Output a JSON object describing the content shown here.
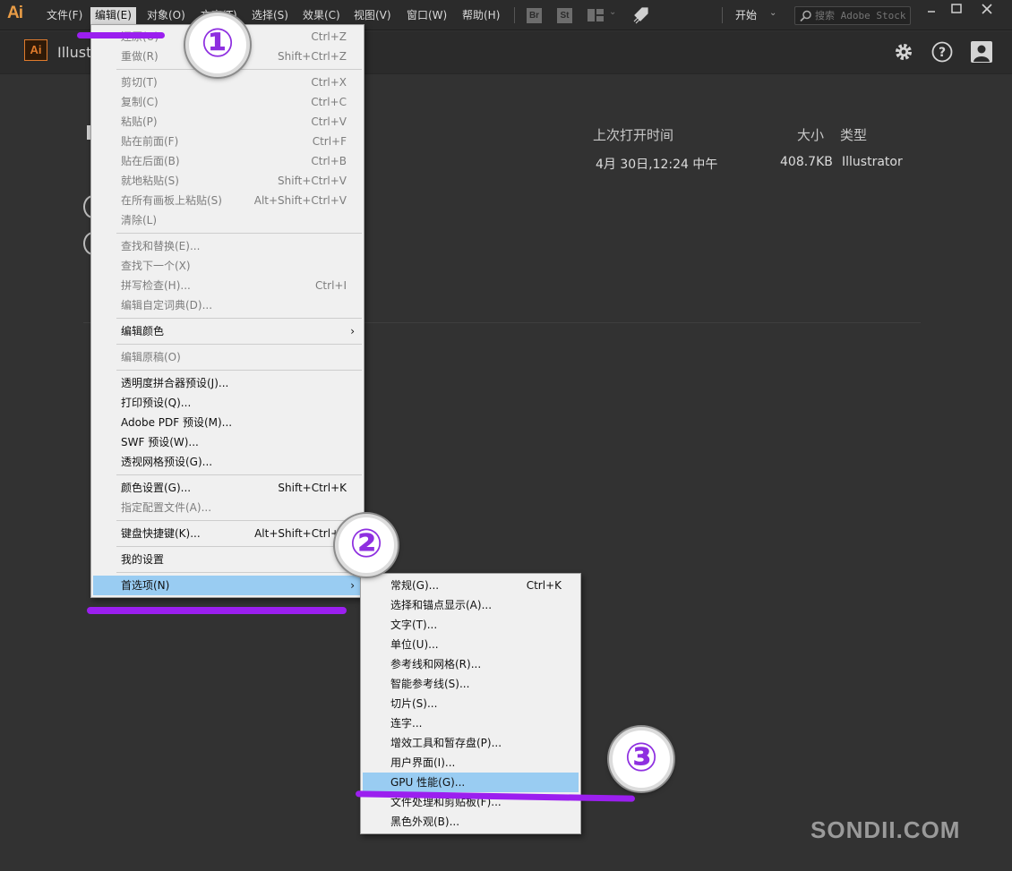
{
  "app": {
    "logo": "Ai",
    "name": "Illust"
  },
  "menubar": {
    "items": [
      {
        "label": "文件(F)"
      },
      {
        "label": "编辑(E)"
      },
      {
        "label": "对象(O)"
      },
      {
        "label": "文字(T)"
      },
      {
        "label": "选择(S)"
      },
      {
        "label": "效果(C)"
      },
      {
        "label": "视图(V)"
      },
      {
        "label": "窗口(W)"
      },
      {
        "label": "帮助(H)"
      }
    ],
    "bridge_icon": "Br",
    "stock_icon": "St",
    "workspace": "开始",
    "search_placeholder": "搜索 Adobe Stock"
  },
  "recent": {
    "columns": {
      "last_opened": "上次打开时间",
      "size": "大小",
      "type": "类型"
    },
    "row": {
      "last_opened": "4月 30日,12:24 中午",
      "size": "408.7KB",
      "type": "Illustrator"
    }
  },
  "edit_menu": {
    "items": [
      {
        "label": "还原(U)",
        "shortcut": "Ctrl+Z"
      },
      {
        "label": "重做(R)",
        "shortcut": "Shift+Ctrl+Z"
      },
      {
        "label": "剪切(T)",
        "shortcut": "Ctrl+X"
      },
      {
        "label": "复制(C)",
        "shortcut": "Ctrl+C"
      },
      {
        "label": "粘贴(P)",
        "shortcut": "Ctrl+V"
      },
      {
        "label": "贴在前面(F)",
        "shortcut": "Ctrl+F"
      },
      {
        "label": "贴在后面(B)",
        "shortcut": "Ctrl+B"
      },
      {
        "label": "就地粘贴(S)",
        "shortcut": "Shift+Ctrl+V"
      },
      {
        "label": "在所有画板上粘贴(S)",
        "shortcut": "Alt+Shift+Ctrl+V"
      },
      {
        "label": "清除(L)",
        "shortcut": ""
      },
      {
        "label": "查找和替换(E)...",
        "shortcut": ""
      },
      {
        "label": "查找下一个(X)",
        "shortcut": ""
      },
      {
        "label": "拼写检查(H)...",
        "shortcut": "Ctrl+I"
      },
      {
        "label": "编辑自定词典(D)...",
        "shortcut": ""
      },
      {
        "label": "编辑颜色",
        "shortcut": ""
      },
      {
        "label": "编辑原稿(O)",
        "shortcut": ""
      },
      {
        "label": "透明度拼合器预设(J)...",
        "shortcut": ""
      },
      {
        "label": "打印预设(Q)...",
        "shortcut": ""
      },
      {
        "label": "Adobe PDF 预设(M)...",
        "shortcut": ""
      },
      {
        "label": "SWF 预设(W)...",
        "shortcut": ""
      },
      {
        "label": "透视网格预设(G)...",
        "shortcut": ""
      },
      {
        "label": "颜色设置(G)...",
        "shortcut": "Shift+Ctrl+K"
      },
      {
        "label": "指定配置文件(A)...",
        "shortcut": ""
      },
      {
        "label": "键盘快捷键(K)...",
        "shortcut": "Alt+Shift+Ctrl+K"
      },
      {
        "label": "我的设置",
        "shortcut": ""
      },
      {
        "label": "首选项(N)",
        "shortcut": ""
      }
    ]
  },
  "prefs_menu": {
    "items": [
      {
        "label": "常规(G)...",
        "shortcut": "Ctrl+K"
      },
      {
        "label": "选择和锚点显示(A)..."
      },
      {
        "label": "文字(T)..."
      },
      {
        "label": "单位(U)..."
      },
      {
        "label": "参考线和网格(R)..."
      },
      {
        "label": "智能参考线(S)..."
      },
      {
        "label": "切片(S)..."
      },
      {
        "label": "连字..."
      },
      {
        "label": "增效工具和暂存盘(P)..."
      },
      {
        "label": "用户界面(I)..."
      },
      {
        "label": "GPU 性能(G)..."
      },
      {
        "label": "文件处理和剪贴板(F)..."
      },
      {
        "label": "黑色外观(B)..."
      }
    ]
  },
  "annotations": {
    "step1": "①",
    "step2": "②",
    "step3": "③",
    "accent": "#9b1fef"
  },
  "watermark": "SONDII.COM"
}
